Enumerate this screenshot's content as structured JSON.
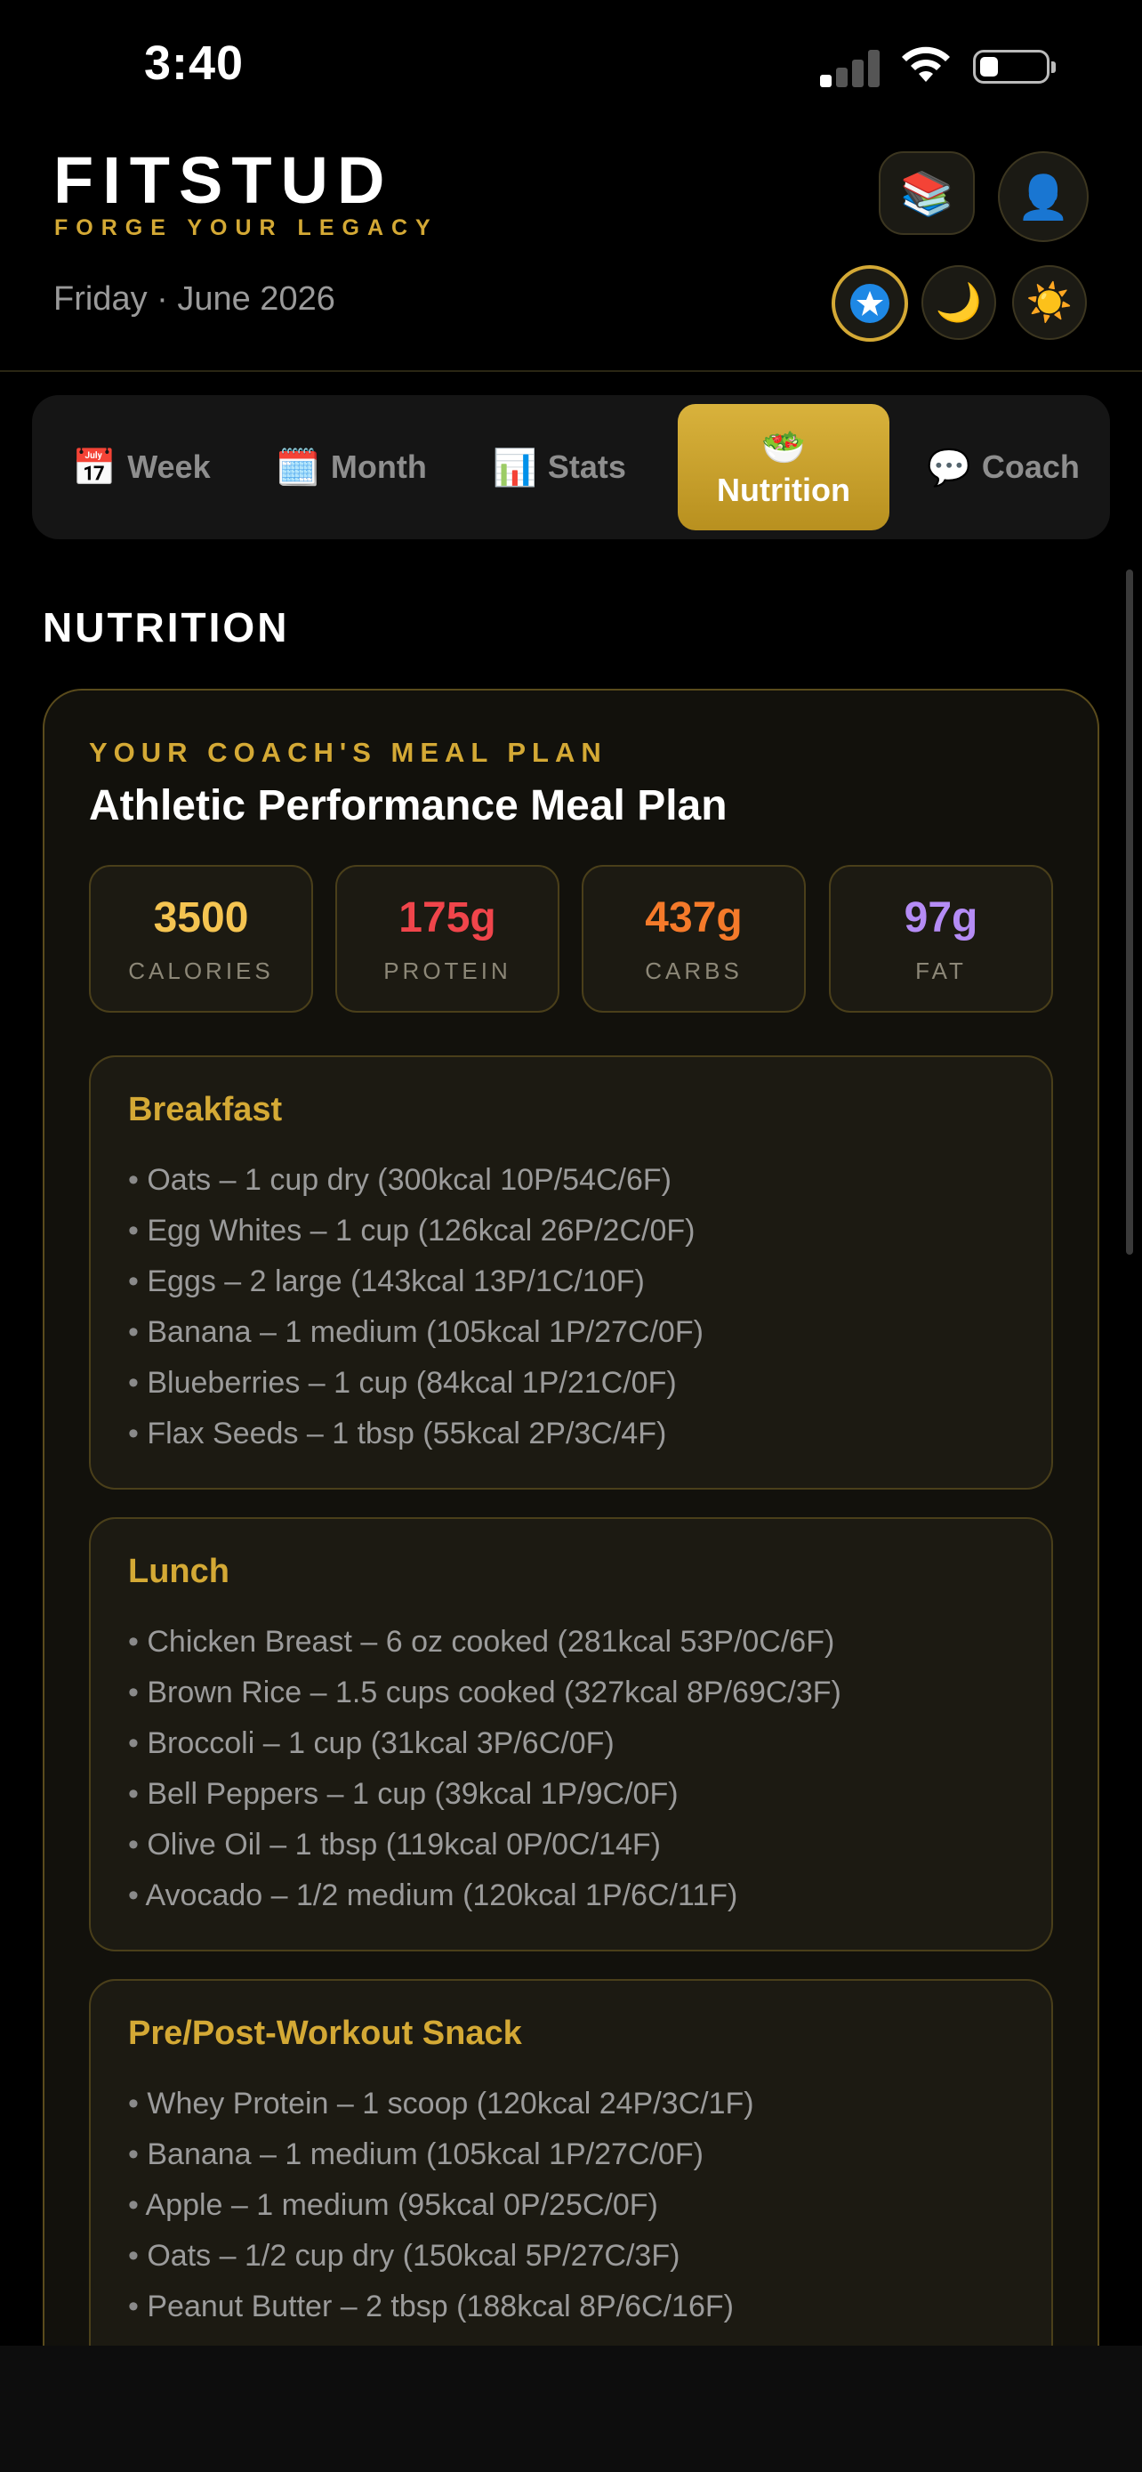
{
  "status": {
    "time": "3:40"
  },
  "header": {
    "brand": "FITSTUD",
    "tagline": "FORGE YOUR LEGACY",
    "date": "Friday · June 2026",
    "icons": [
      "books-icon",
      "user-icon",
      "star-icon",
      "moon-icon",
      "sun-icon"
    ]
  },
  "tabs": [
    {
      "icon": "📅",
      "label": "Week"
    },
    {
      "icon": "🗓️",
      "label": "Month"
    },
    {
      "icon": "📊",
      "label": "Stats"
    },
    {
      "icon": "🥗",
      "label": "Nutrition"
    },
    {
      "icon": "💬",
      "label": "Coach"
    }
  ],
  "active_tab": "Nutrition",
  "section_title": "NUTRITION",
  "plan": {
    "kicker": "YOUR COACH'S MEAL PLAN",
    "name": "Athletic Performance Meal Plan",
    "macros": [
      {
        "value": "3500",
        "label": "CALORIES",
        "color": "#f5c451"
      },
      {
        "value": "175g",
        "label": "PROTEIN",
        "color": "#f0454b"
      },
      {
        "value": "437g",
        "label": "CARBS",
        "color": "#f57a2a"
      },
      {
        "value": "97g",
        "label": "FAT",
        "color": "#b58cf5"
      }
    ],
    "meals": [
      {
        "title": "Breakfast",
        "items": [
          "Oats – 1 cup dry (300kcal 10P/54C/6F)",
          "Egg Whites – 1 cup (126kcal 26P/2C/0F)",
          "Eggs – 2 large (143kcal 13P/1C/10F)",
          "Banana – 1 medium (105kcal 1P/27C/0F)",
          "Blueberries – 1 cup (84kcal 1P/21C/0F)",
          "Flax Seeds – 1 tbsp (55kcal 2P/3C/4F)"
        ]
      },
      {
        "title": "Lunch",
        "items": [
          "Chicken Breast – 6 oz cooked (281kcal 53P/0C/6F)",
          "Brown Rice – 1.5 cups cooked (327kcal 8P/69C/3F)",
          "Broccoli – 1 cup (31kcal 3P/6C/0F)",
          "Bell Peppers – 1 cup (39kcal 1P/9C/0F)",
          "Olive Oil – 1 tbsp (119kcal 0P/0C/14F)",
          "Avocado – 1/2 medium (120kcal 1P/6C/11F)"
        ]
      },
      {
        "title": "Pre/Post-Workout Snack",
        "items": [
          "Whey Protein – 1 scoop (120kcal 24P/3C/1F)",
          "Banana – 1 medium (105kcal 1P/27C/0F)",
          "Apple – 1 medium (95kcal 0P/25C/0F)",
          "Oats – 1/2 cup dry (150kcal 5P/27C/3F)",
          "Peanut Butter – 2 tbsp (188kcal 8P/6C/16F)"
        ]
      }
    ]
  }
}
